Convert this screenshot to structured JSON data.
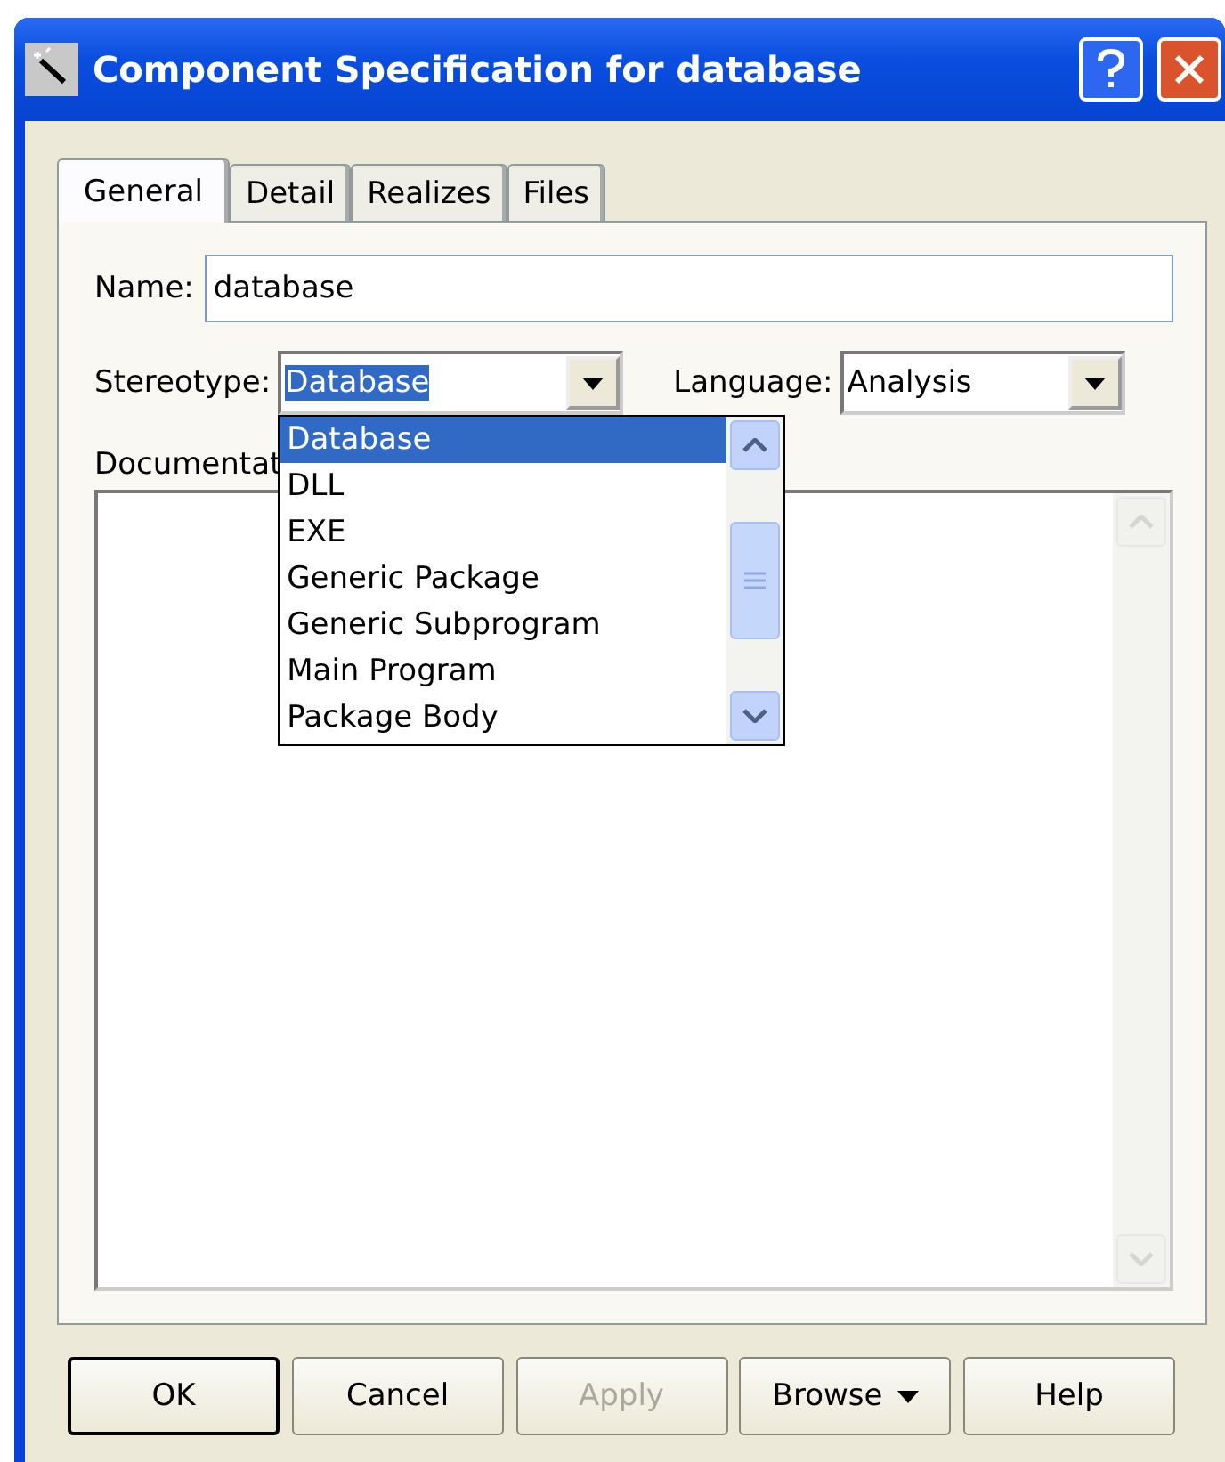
{
  "window": {
    "title": "Component Specification for database"
  },
  "tabs": [
    {
      "label": "General",
      "selected": true
    },
    {
      "label": "Detail",
      "selected": false
    },
    {
      "label": "Realizes",
      "selected": false
    },
    {
      "label": "Files",
      "selected": false
    }
  ],
  "name": {
    "label": "Name:",
    "value": "database"
  },
  "stereotype": {
    "label": "Stereotype:",
    "value": "Database",
    "expanded": true,
    "options": [
      {
        "label": "Database",
        "selected": true
      },
      {
        "label": "DLL",
        "selected": false
      },
      {
        "label": "EXE",
        "selected": false
      },
      {
        "label": "Generic Package",
        "selected": false
      },
      {
        "label": "Generic Subprogram",
        "selected": false
      },
      {
        "label": "Main Program",
        "selected": false
      },
      {
        "label": "Package Body",
        "selected": false
      }
    ]
  },
  "language": {
    "label": "Language:",
    "value": "Analysis"
  },
  "documentation": {
    "label": "Documentat"
  },
  "buttons": [
    {
      "label": "OK",
      "default": true,
      "disabled": false,
      "kind": "plain"
    },
    {
      "label": "Cancel",
      "default": false,
      "disabled": false,
      "kind": "plain"
    },
    {
      "label": "Apply",
      "default": false,
      "disabled": true,
      "kind": "plain"
    },
    {
      "label": "Browse",
      "default": false,
      "disabled": false,
      "kind": "menu"
    },
    {
      "label": "Help",
      "default": false,
      "disabled": false,
      "kind": "plain"
    }
  ]
}
